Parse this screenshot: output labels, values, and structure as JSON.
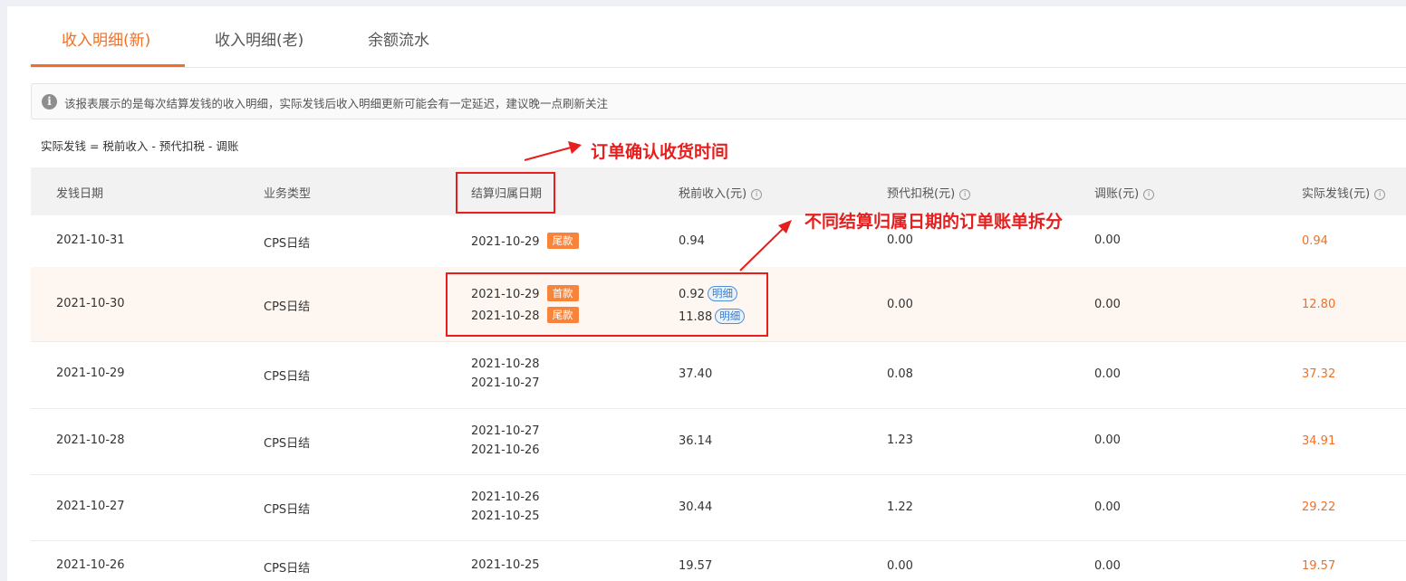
{
  "tabs": [
    {
      "label": "收入明细(新)",
      "active": true
    },
    {
      "label": "收入明细(老)",
      "active": false
    },
    {
      "label": "余额流水",
      "active": false
    }
  ],
  "notice": {
    "icon": "info-icon",
    "text": "该报表展示的是每次结算发钱的收入明细，实际发钱后收入明细更新可能会有一定延迟，建议晚一点刷新关注"
  },
  "formula": "实际发钱 = 税前收入 - 预代扣税 - 调账",
  "table": {
    "headers": [
      "发钱日期",
      "业务类型",
      "结算归属日期",
      "税前收入(元)",
      "预代扣税(元)",
      "调账(元)",
      "实际发钱(元)"
    ],
    "help_icon": "ⓘ",
    "rows": [
      {
        "pay_date": "2021-10-31",
        "type": "CPS日结",
        "settle": [
          "2021-10-29"
        ],
        "settle_tags": [
          "尾款"
        ],
        "pretax": [
          "0.94"
        ],
        "detail_links": [],
        "tax": "0.00",
        "adjust": "0.00",
        "actual": "0.94"
      },
      {
        "pay_date": "2021-10-30",
        "type": "CPS日结",
        "settle": [
          "2021-10-29",
          "2021-10-28"
        ],
        "settle_tags": [
          "首款",
          "尾款"
        ],
        "pretax": [
          "0.92",
          "11.88"
        ],
        "detail_links": [
          "明细",
          "明细"
        ],
        "tax": "0.00",
        "adjust": "0.00",
        "actual": "12.80"
      },
      {
        "pay_date": "2021-10-29",
        "type": "CPS日结",
        "settle": [
          "2021-10-28",
          "2021-10-27"
        ],
        "settle_tags": [],
        "pretax": [
          "37.40"
        ],
        "detail_links": [],
        "tax": "0.08",
        "adjust": "0.00",
        "actual": "37.32"
      },
      {
        "pay_date": "2021-10-28",
        "type": "CPS日结",
        "settle": [
          "2021-10-27",
          "2021-10-26"
        ],
        "settle_tags": [],
        "pretax": [
          "36.14"
        ],
        "detail_links": [],
        "tax": "1.23",
        "adjust": "0.00",
        "actual": "34.91"
      },
      {
        "pay_date": "2021-10-27",
        "type": "CPS日结",
        "settle": [
          "2021-10-26",
          "2021-10-25"
        ],
        "settle_tags": [],
        "pretax": [
          "30.44"
        ],
        "detail_links": [],
        "tax": "1.22",
        "adjust": "0.00",
        "actual": "29.22"
      },
      {
        "pay_date": "2021-10-26",
        "type": "CPS日结",
        "settle": [
          "2021-10-25"
        ],
        "settle_tags": [],
        "pretax": [
          "19.57"
        ],
        "detail_links": [],
        "tax": "0.00",
        "adjust": "0.00",
        "actual": "19.57"
      }
    ]
  },
  "annotations": {
    "confirm_time": "订单确认收货时间",
    "split": "不同结算归属日期的订单账单拆分"
  },
  "colors": {
    "accent": "#f27025",
    "annotation": "#e61e1e",
    "link": "#3a7bcf"
  }
}
